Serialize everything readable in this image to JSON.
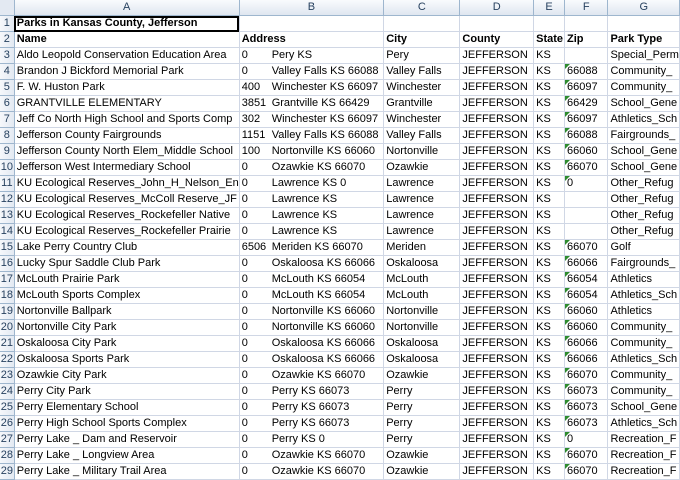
{
  "columns": [
    "A",
    "B",
    "C",
    "D",
    "E",
    "F",
    "G"
  ],
  "title_row": {
    "row": "1",
    "text": "Parks in Kansas County, Jefferson"
  },
  "header_row": {
    "row": "2",
    "cells": [
      "Name",
      "Address",
      "City",
      "County",
      "State",
      "Zip",
      "Park Type"
    ]
  },
  "rows": [
    {
      "row": "3",
      "name": "Aldo Leopold Conservation Education Area",
      "addr_num": "0",
      "addr": "Pery KS",
      "city": "Pery",
      "county": "JEFFERSON",
      "state": "KS",
      "zip": "",
      "type": "Special_Perm",
      "flag": false
    },
    {
      "row": "4",
      "name": "Brandon J Bickford Memorial Park",
      "addr_num": "0",
      "addr": "Valley Falls KS 66088",
      "city": "Valley Falls",
      "county": "JEFFERSON",
      "state": "KS",
      "zip": "66088",
      "type": "Community_",
      "flag": true
    },
    {
      "row": "5",
      "name": "F. W. Huston Park",
      "addr_num": "400",
      "addr": "Winchester KS 66097",
      "city": "Winchester",
      "county": "JEFFERSON",
      "state": "KS",
      "zip": "66097",
      "type": "Community_",
      "flag": true
    },
    {
      "row": "6",
      "name": "GRANTVILLE ELEMENTARY",
      "addr_num": "3851",
      "addr": "Grantville KS 66429",
      "city": "Grantville",
      "county": "JEFFERSON",
      "state": "KS",
      "zip": "66429",
      "type": "School_Gene",
      "flag": true
    },
    {
      "row": "7",
      "name": "Jeff Co North High School and Sports Comp",
      "addr_num": "302",
      "addr": "Winchester KS 66097",
      "city": "Winchester",
      "county": "JEFFERSON",
      "state": "KS",
      "zip": "66097",
      "type": "Athletics_Sch",
      "flag": true
    },
    {
      "row": "8",
      "name": "Jefferson County Fairgrounds",
      "addr_num": "1151",
      "addr": "Valley Falls KS 66088",
      "city": "Valley Falls",
      "county": "JEFFERSON",
      "state": "KS",
      "zip": "66088",
      "type": "Fairgrounds_",
      "flag": true
    },
    {
      "row": "9",
      "name": "Jefferson County North Elem_Middle School",
      "addr_num": "100",
      "addr": "Nortonville KS 66060",
      "city": "Nortonville",
      "county": "JEFFERSON",
      "state": "KS",
      "zip": "66060",
      "type": "School_Gene",
      "flag": true
    },
    {
      "row": "10",
      "name": "Jefferson West Intermediary School",
      "addr_num": "0",
      "addr": "Ozawkie KS 66070",
      "city": "Ozawkie",
      "county": "JEFFERSON",
      "state": "KS",
      "zip": "66070",
      "type": "School_Gene",
      "flag": true
    },
    {
      "row": "11",
      "name": "KU Ecological Reserves_John_H_Nelson_En",
      "addr_num": "0",
      "addr": "Lawrence KS 0",
      "city": "Lawrence",
      "county": "JEFFERSON",
      "state": "KS",
      "zip": "0",
      "type": "Other_Refug",
      "flag": true
    },
    {
      "row": "12",
      "name": "KU Ecological Reserves_McColl Reserve_JF",
      "addr_num": "0",
      "addr": "Lawrence KS",
      "city": "Lawrence",
      "county": "JEFFERSON",
      "state": "KS",
      "zip": "",
      "type": "Other_Refug",
      "flag": false
    },
    {
      "row": "13",
      "name": "KU Ecological Reserves_Rockefeller Native",
      "addr_num": "0",
      "addr": "Lawrence KS",
      "city": "Lawrence",
      "county": "JEFFERSON",
      "state": "KS",
      "zip": "",
      "type": "Other_Refug",
      "flag": false
    },
    {
      "row": "14",
      "name": "KU Ecological Reserves_Rockefeller Prairie",
      "addr_num": "0",
      "addr": "Lawrence KS",
      "city": "Lawrence",
      "county": "JEFFERSON",
      "state": "KS",
      "zip": "",
      "type": "Other_Refug",
      "flag": false
    },
    {
      "row": "15",
      "name": "Lake Perry Country Club",
      "addr_num": "6506",
      "addr": "Meriden KS 66070",
      "city": "Meriden",
      "county": "JEFFERSON",
      "state": "KS",
      "zip": "66070",
      "type": "Golf",
      "flag": true
    },
    {
      "row": "16",
      "name": "Lucky Spur Saddle Club Park",
      "addr_num": "0",
      "addr": "Oskaloosa KS 66066",
      "city": "Oskaloosa",
      "county": "JEFFERSON",
      "state": "KS",
      "zip": "66066",
      "type": "Fairgrounds_",
      "flag": true
    },
    {
      "row": "17",
      "name": "McLouth Prairie Park",
      "addr_num": "0",
      "addr": "McLouth KS 66054",
      "city": "McLouth",
      "county": "JEFFERSON",
      "state": "KS",
      "zip": "66054",
      "type": "Athletics",
      "flag": true
    },
    {
      "row": "18",
      "name": "McLouth Sports Complex",
      "addr_num": "0",
      "addr": "McLouth KS 66054",
      "city": "McLouth",
      "county": "JEFFERSON",
      "state": "KS",
      "zip": "66054",
      "type": "Athletics_Sch",
      "flag": true
    },
    {
      "row": "19",
      "name": "Nortonville Ballpark",
      "addr_num": "0",
      "addr": "Nortonville KS 66060",
      "city": "Nortonville",
      "county": "JEFFERSON",
      "state": "KS",
      "zip": "66060",
      "type": "Athletics",
      "flag": true
    },
    {
      "row": "20",
      "name": "Nortonville City Park",
      "addr_num": "0",
      "addr": "Nortonville KS 66060",
      "city": "Nortonville",
      "county": "JEFFERSON",
      "state": "KS",
      "zip": "66060",
      "type": "Community_",
      "flag": true
    },
    {
      "row": "21",
      "name": "Oskaloosa City Park",
      "addr_num": "0",
      "addr": "Oskaloosa KS 66066",
      "city": "Oskaloosa",
      "county": "JEFFERSON",
      "state": "KS",
      "zip": "66066",
      "type": "Community_",
      "flag": true
    },
    {
      "row": "22",
      "name": "Oskaloosa Sports Park",
      "addr_num": "0",
      "addr": "Oskaloosa KS 66066",
      "city": "Oskaloosa",
      "county": "JEFFERSON",
      "state": "KS",
      "zip": "66066",
      "type": "Athletics_Sch",
      "flag": true
    },
    {
      "row": "23",
      "name": "Ozawkie City Park",
      "addr_num": "0",
      "addr": "Ozawkie KS 66070",
      "city": "Ozawkie",
      "county": "JEFFERSON",
      "state": "KS",
      "zip": "66070",
      "type": "Community_",
      "flag": true
    },
    {
      "row": "24",
      "name": "Perry City Park",
      "addr_num": "0",
      "addr": "Perry KS 66073",
      "city": "Perry",
      "county": "JEFFERSON",
      "state": "KS",
      "zip": "66073",
      "type": "Community_",
      "flag": true
    },
    {
      "row": "25",
      "name": "Perry Elementary School",
      "addr_num": "0",
      "addr": "Perry KS 66073",
      "city": "Perry",
      "county": "JEFFERSON",
      "state": "KS",
      "zip": "66073",
      "type": "School_Gene",
      "flag": true
    },
    {
      "row": "26",
      "name": "Perry High School Sports Complex",
      "addr_num": "0",
      "addr": "Perry KS 66073",
      "city": "Perry",
      "county": "JEFFERSON",
      "state": "KS",
      "zip": "66073",
      "type": "Athletics_Sch",
      "flag": true
    },
    {
      "row": "27",
      "name": "Perry Lake _ Dam and Reservoir",
      "addr_num": "0",
      "addr": "Perry KS 0",
      "city": "Perry",
      "county": "JEFFERSON",
      "state": "KS",
      "zip": "0",
      "type": "Recreation_F",
      "flag": true
    },
    {
      "row": "28",
      "name": "Perry Lake _ Longview Area",
      "addr_num": "0",
      "addr": "Ozawkie KS 66070",
      "city": "Ozawkie",
      "county": "JEFFERSON",
      "state": "KS",
      "zip": "66070",
      "type": "Recreation_F",
      "flag": true
    },
    {
      "row": "29",
      "name": "Perry Lake _ Military Trail Area",
      "addr_num": "0",
      "addr": "Ozawkie KS 66070",
      "city": "Ozawkie",
      "county": "JEFFERSON",
      "state": "KS",
      "zip": "66070",
      "type": "Recreation_F",
      "flag": true
    }
  ],
  "colors": {
    "header_bg": "#dfe6f0",
    "gridline": "#d0d7e5",
    "error_flag": "#2e8b2e"
  }
}
